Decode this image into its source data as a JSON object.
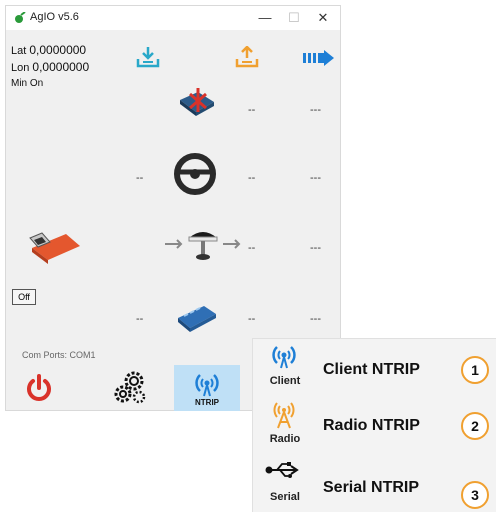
{
  "window": {
    "title": "AgIO v5.6",
    "minimize": "—",
    "maximize": "☐",
    "close": "✕"
  },
  "coords": {
    "lat_label": "Lat",
    "lat_value": "0,0000000",
    "lon_label": "Lon",
    "lon_value": "0,0000000",
    "min_label": "Min",
    "min_value": "On"
  },
  "rows": {
    "imu": {
      "a": "--",
      "b": "---"
    },
    "steer": {
      "left": "--",
      "a": "--",
      "b": "---"
    },
    "gps": {
      "a": "--",
      "b": "---"
    },
    "machine": {
      "left": "--",
      "a": "--",
      "b": "---"
    }
  },
  "off_button": "Off",
  "com_ports": {
    "label": "Com Ports:",
    "value": "COM1"
  },
  "ntrip_button": "NTRIP",
  "menu": {
    "items": [
      {
        "icon": "client-icon",
        "short": "Client",
        "label": "Client NTRIP",
        "num": "1"
      },
      {
        "icon": "radio-icon",
        "short": "Radio",
        "label": "Radio NTRIP",
        "num": "2"
      },
      {
        "icon": "usb-icon",
        "short": "Serial",
        "label": "Serial NTRIP",
        "num": "3"
      }
    ]
  },
  "colors": {
    "accent_blue": "#1e7fd6",
    "orange": "#f0a030",
    "red": "#d9322a",
    "teal": "#29a8c9"
  }
}
